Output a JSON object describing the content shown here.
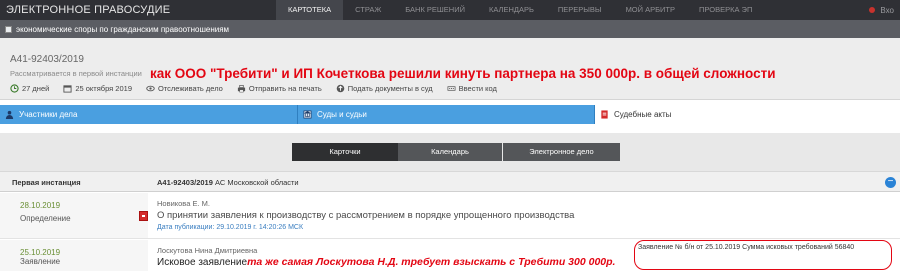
{
  "topbar": {
    "brand": "ЭЛЕКТРОННОЕ ПРАВОСУДИЕ",
    "nav": [
      "КАРТОТЕКА",
      "СТРАЖ",
      "БАНК РЕШЕНИЙ",
      "КАЛЕНДАРЬ",
      "ПЕРЕРЫВЫ",
      "МОЙ АРБИТР",
      "ПРОВЕРКА ЭП"
    ],
    "active_nav": "КАРТОТЕКА",
    "login_label": "Вхо"
  },
  "category": "экономические споры по гражданским правоотношениям",
  "case": {
    "number": "А41-92403/2019",
    "status": "Рассматривается в первой инстанции",
    "headline": "как ООО \"Требити\" и ИП Кочеткова решили кинуть партнера на 350 000р. в общей сложности",
    "days": "27 дней",
    "date": "25 октября 2019",
    "tools": [
      "Отслеживать дело",
      "Отправить на печать",
      "Подать документы в суд",
      "Ввести код"
    ]
  },
  "tabs": [
    "Участники дела",
    "Суды и судьи",
    "Судебные акты"
  ],
  "subtabs": [
    "Карточки",
    "Календарь",
    "Электронное дело"
  ],
  "table": {
    "instance": "Первая инстанция",
    "case_ref": "А41-92403/2019",
    "court": "АС Московской области"
  },
  "rows": [
    {
      "date": "28.10.2019",
      "type": "Определение",
      "judge": "Новикова Е. М.",
      "description": "О принятии заявления к производству с рассмотрением в порядке упрощенного производства",
      "pub_date": "Дата публикации: 29.10.2019 г. 14:20:26 МСК"
    },
    {
      "date": "25.10.2019",
      "type": "Заявление",
      "judge": "Лоскутова Нина Дмитриевна",
      "description": "Исковое заявление",
      "annotation": "та же самая Лоскутова Н.Д. требует взыскать с Требити 300 000р.",
      "claim": "Заявление № б/н от 25.10.2019   Сумма исковых требований 56840"
    }
  ],
  "colors": {
    "accent_red": "#e30613",
    "tab_blue": "#4a9fe0",
    "nav_dark": "#2f3035"
  }
}
